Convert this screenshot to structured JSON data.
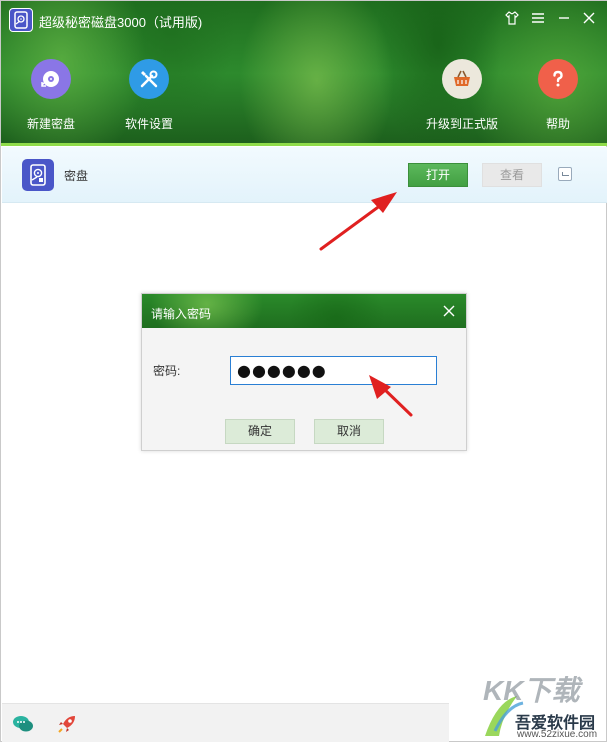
{
  "app": {
    "title": "超级秘密磁盘3000（试用版)"
  },
  "window_controls": {
    "skin_icon": "shirt-icon",
    "menu_icon": "menu-icon",
    "minimize_icon": "minimize-icon",
    "close_icon": "close-icon"
  },
  "toolbar": {
    "new_disk": {
      "label": "新建密盘",
      "icon": "disk-add-icon",
      "color": "#7e6de0"
    },
    "settings": {
      "label": "软件设置",
      "icon": "tools-icon",
      "color": "#2f9be6"
    },
    "upgrade": {
      "label": "升级到正式版",
      "icon": "basket-icon",
      "color": "#e7e3d6"
    },
    "help": {
      "label": "帮助",
      "icon": "help-icon",
      "color": "#f0604a"
    }
  },
  "disk_row": {
    "name": "密盘",
    "open_label": "打开",
    "view_label": "查看"
  },
  "dialog": {
    "title": "请输入密码",
    "password_label": "密码:",
    "password_value": "●●●●●●",
    "ok_label": "确定",
    "cancel_label": "取消"
  },
  "footer": {
    "icons": [
      "chat-icon",
      "rocket-icon"
    ]
  },
  "watermark": {
    "big_text": "KK下载",
    "site_name": "吾爱软件园",
    "url": "www.52zixue.com"
  },
  "colors": {
    "accent_green": "#42a042",
    "header_green": "#2d8a2d",
    "annotation_red": "#e02020"
  }
}
